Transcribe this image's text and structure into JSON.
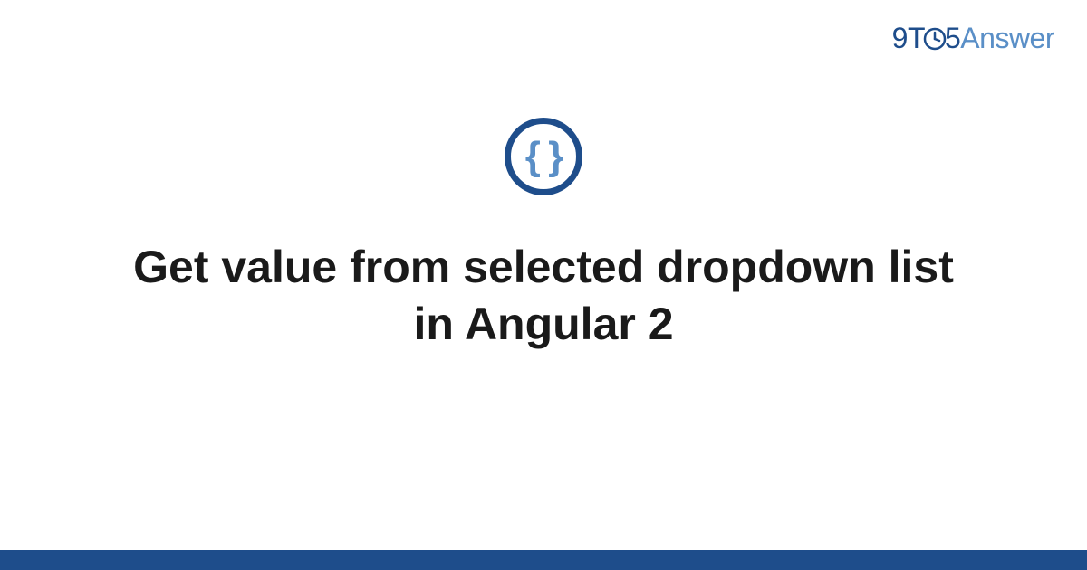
{
  "brand": {
    "part1": "9T",
    "part2": "5",
    "part3": "Answer"
  },
  "icon": {
    "name": "code-braces-icon",
    "glyph": "{ }"
  },
  "title": "Get value from selected dropdown list in Angular 2",
  "colors": {
    "primary": "#1e4d8b",
    "accent": "#5a8fc7",
    "text": "#1a1a1a"
  }
}
